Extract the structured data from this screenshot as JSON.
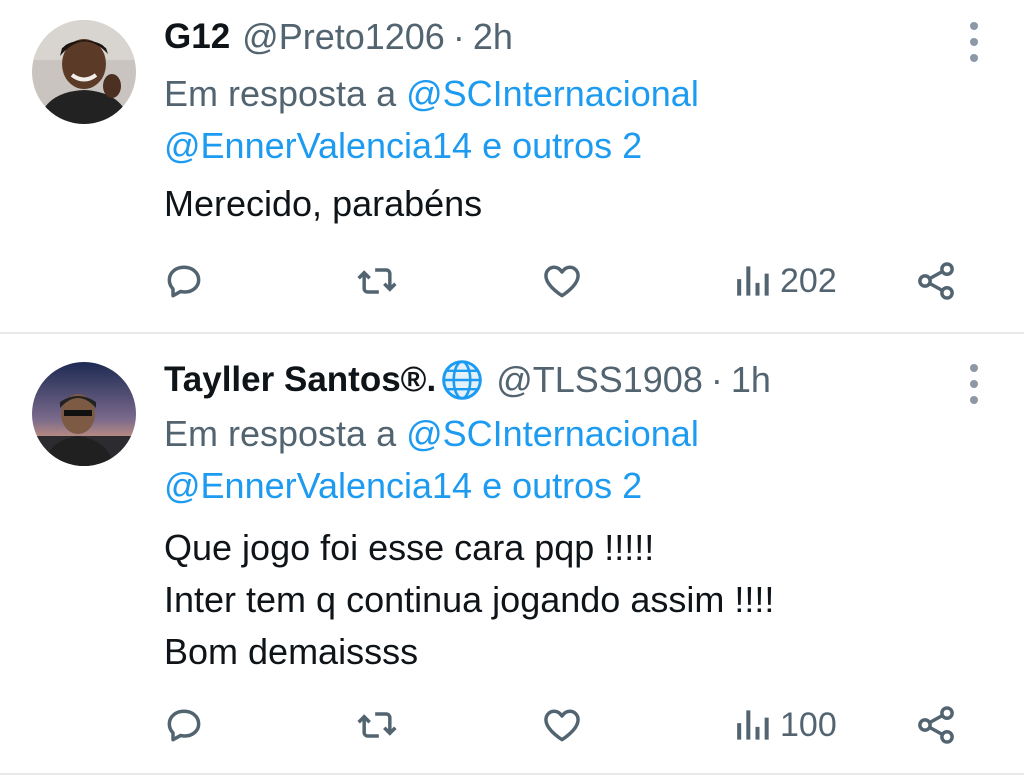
{
  "tweets": [
    {
      "display_name": "G12",
      "verified_badge": false,
      "handle": "@Preto1206",
      "separator": "·",
      "time": "2h",
      "reply_prefix": "Em resposta a",
      "reply_mention_1": "@SCInternacional",
      "reply_mention_2": "@EnnerValencia14 e outros 2",
      "text_lines": [
        "Merecido, parabéns"
      ],
      "views": "202"
    },
    {
      "display_name": "Tayller Santos®.",
      "verified_badge": "globe-icon",
      "handle": "@TLSS1908",
      "separator": "·",
      "time": "1h",
      "reply_prefix": "Em resposta a",
      "reply_mention_1": "@SCInternacional",
      "reply_mention_2": "@EnnerValencia14 e outros 2",
      "text_lines": [
        "Que jogo foi esse cara pqp !!!!!",
        "Inter tem q continua jogando assim !!!!",
        "Bom demaissss"
      ],
      "views": "100"
    }
  ],
  "icons": {
    "reply": "reply-icon",
    "retweet": "retweet-icon",
    "like": "heart-icon",
    "views": "views-icon",
    "share": "share-icon",
    "more": "more-vertical-icon"
  },
  "colors": {
    "text": "#0f1419",
    "secondary": "#536471",
    "link": "#1d9bf0",
    "divider": "#e7e9ea"
  }
}
